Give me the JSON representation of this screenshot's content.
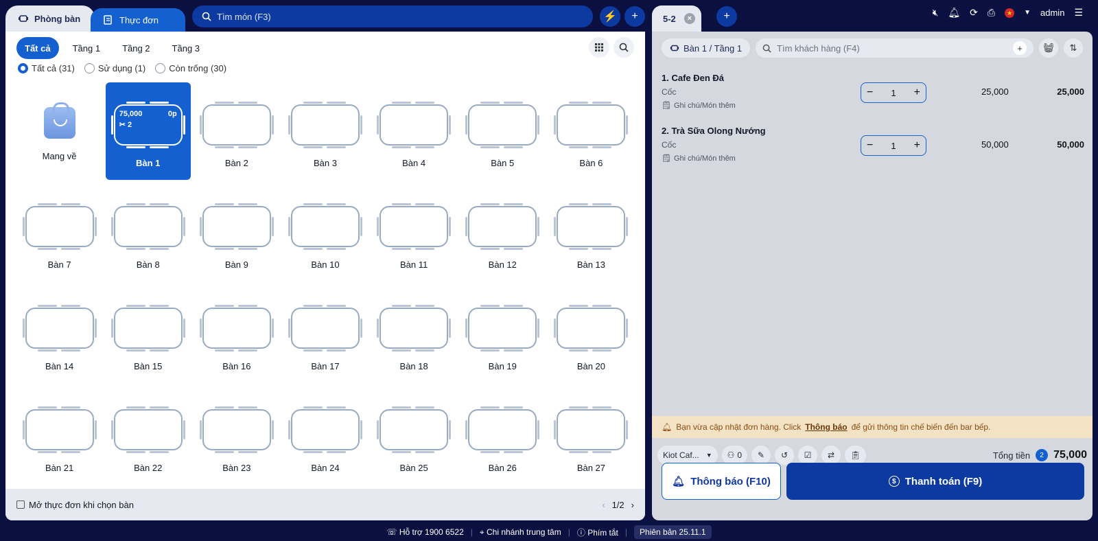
{
  "colors": {
    "brand": "#1560d0",
    "dark_brand": "#0d3aa0",
    "background": "#0a1140"
  },
  "top_left": {
    "tab_room": "Phòng bàn",
    "tab_menu": "Thực đơn",
    "search_placeholder": "Tìm món (F3)"
  },
  "floor_tabs": [
    {
      "label": "Tất cả",
      "active": true
    },
    {
      "label": "Tầng 1"
    },
    {
      "label": "Tầng 2"
    },
    {
      "label": "Tầng 3"
    }
  ],
  "filters": [
    {
      "label": "Tất cả (31)",
      "active": true
    },
    {
      "label": "Sử dụng (1)"
    },
    {
      "label": "Còn trống (30)"
    }
  ],
  "takeaway_label": "Mang về",
  "active_table": {
    "label": "Bàn 1",
    "amount": "75,000",
    "time": "0p",
    "guests": "2"
  },
  "tables": [
    "Bàn 2",
    "Bàn 3",
    "Bàn 4",
    "Bàn 5",
    "Bàn 6",
    "Bàn 7",
    "Bàn 8",
    "Bàn 9",
    "Bàn 10",
    "Bàn 11",
    "Bàn 12",
    "Bàn 13",
    "Bàn 14",
    "Bàn 15",
    "Bàn 16",
    "Bàn 17",
    "Bàn 18",
    "Bàn 19",
    "Bàn 20",
    "Bàn 21",
    "Bàn 22",
    "Bàn 23",
    "Bàn 24",
    "Bàn 25",
    "Bàn 26",
    "Bàn 27"
  ],
  "left_footer": {
    "checkbox_label": "Mở thực đơn khi chọn bàn",
    "page": "1/2"
  },
  "right": {
    "tab_label": "5-2",
    "user": "admin",
    "table_pill": "Bàn 1 / Tầng 1",
    "customer_placeholder": "Tìm khách hàng (F4)",
    "orders": [
      {
        "name": "1. Cafe Đen Đá",
        "unit": "Cốc",
        "note": "Ghi chú/Món thêm",
        "qty": "1",
        "price": "25,000",
        "total": "25,000"
      },
      {
        "name": "2. Trà Sữa Olong Nướng",
        "unit": "Cốc",
        "note": "Ghi chú/Món thêm",
        "qty": "1",
        "price": "50,000",
        "total": "50,000"
      }
    ],
    "notice": {
      "before": "Bạn vừa cập nhật đơn hàng. Click",
      "link": "Thông báo",
      "after": "để gửi thông tin chế biến đến bar bếp."
    },
    "price_list": "Kiot Caf...",
    "guest_count": "0",
    "total_label": "Tổng tiền",
    "item_count": "2",
    "total_amount": "75,000",
    "btn_notify": "Thông báo (F10)",
    "btn_pay": "Thanh toán (F9)"
  },
  "footer": {
    "support": "Hỗ trợ 1900 6522",
    "branch": "Chi nhánh trung tâm",
    "shortcuts": "Phím tắt",
    "version": "Phiên bản 25.11.1"
  }
}
